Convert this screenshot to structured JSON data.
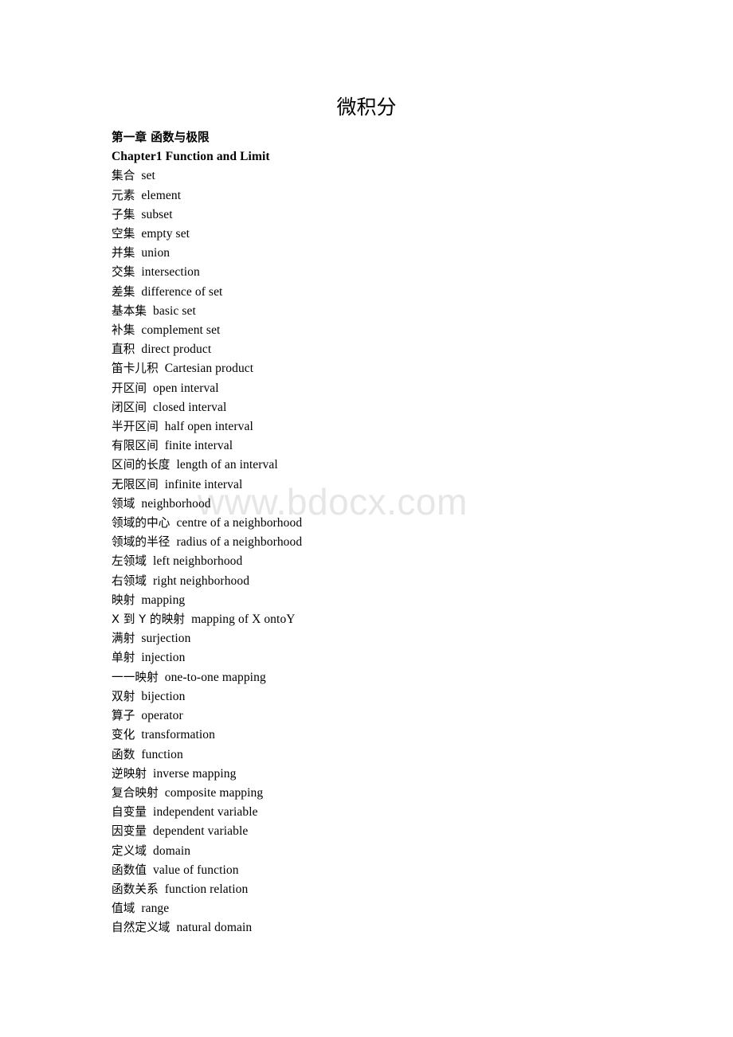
{
  "document": {
    "title": "微积分",
    "watermark": "www.bdocx.com",
    "headings": [
      {
        "cn": "第一章 函数与极限",
        "en": ""
      },
      {
        "cn": "",
        "en": "Chapter1 Function and Limit"
      }
    ],
    "terms": [
      {
        "cn": "集合",
        "en": "set"
      },
      {
        "cn": "元素",
        "en": "element"
      },
      {
        "cn": "子集",
        "en": "subset"
      },
      {
        "cn": "空集",
        "en": "empty set"
      },
      {
        "cn": "并集",
        "en": "union"
      },
      {
        "cn": "交集",
        "en": "intersection"
      },
      {
        "cn": "差集",
        "en": "difference of set"
      },
      {
        "cn": "基本集",
        "en": "basic set"
      },
      {
        "cn": "补集",
        "en": "complement set"
      },
      {
        "cn": "直积",
        "en": "direct product"
      },
      {
        "cn": "笛卡儿积",
        "en": "Cartesian product"
      },
      {
        "cn": "开区间",
        "en": "open interval"
      },
      {
        "cn": "闭区间",
        "en": "closed interval"
      },
      {
        "cn": "半开区间",
        "en": "half open interval"
      },
      {
        "cn": "有限区间",
        "en": "finite interval"
      },
      {
        "cn": "区间的长度",
        "en": "length of an interval"
      },
      {
        "cn": "无限区间",
        "en": "infinite interval"
      },
      {
        "cn": "领域",
        "en": "neighborhood"
      },
      {
        "cn": "领域的中心",
        "en": "centre of a neighborhood"
      },
      {
        "cn": "领域的半径",
        "en": "radius of a neighborhood"
      },
      {
        "cn": "左领域",
        "en": "left neighborhood"
      },
      {
        "cn": "右领域",
        "en": "right neighborhood"
      },
      {
        "cn": "映射",
        "en": "mapping"
      },
      {
        "cn": "X 到 Y 的映射",
        "en": "mapping of X ontoY"
      },
      {
        "cn": "满射",
        "en": "surjection"
      },
      {
        "cn": "单射",
        "en": "injection"
      },
      {
        "cn": "一一映射",
        "en": "one-to-one mapping"
      },
      {
        "cn": "双射",
        "en": "bijection"
      },
      {
        "cn": "算子",
        "en": "operator"
      },
      {
        "cn": "变化",
        "en": "transformation"
      },
      {
        "cn": "函数",
        "en": "function"
      },
      {
        "cn": "逆映射",
        "en": "inverse mapping"
      },
      {
        "cn": "复合映射",
        "en": "composite mapping"
      },
      {
        "cn": "自变量",
        "en": "independent variable"
      },
      {
        "cn": "因变量",
        "en": "dependent variable"
      },
      {
        "cn": "定义域",
        "en": "domain"
      },
      {
        "cn": "函数值",
        "en": "value of function"
      },
      {
        "cn": "函数关系",
        "en": "function relation"
      },
      {
        "cn": "值域",
        "en": "range"
      },
      {
        "cn": "自然定义域",
        "en": "natural domain"
      }
    ]
  }
}
